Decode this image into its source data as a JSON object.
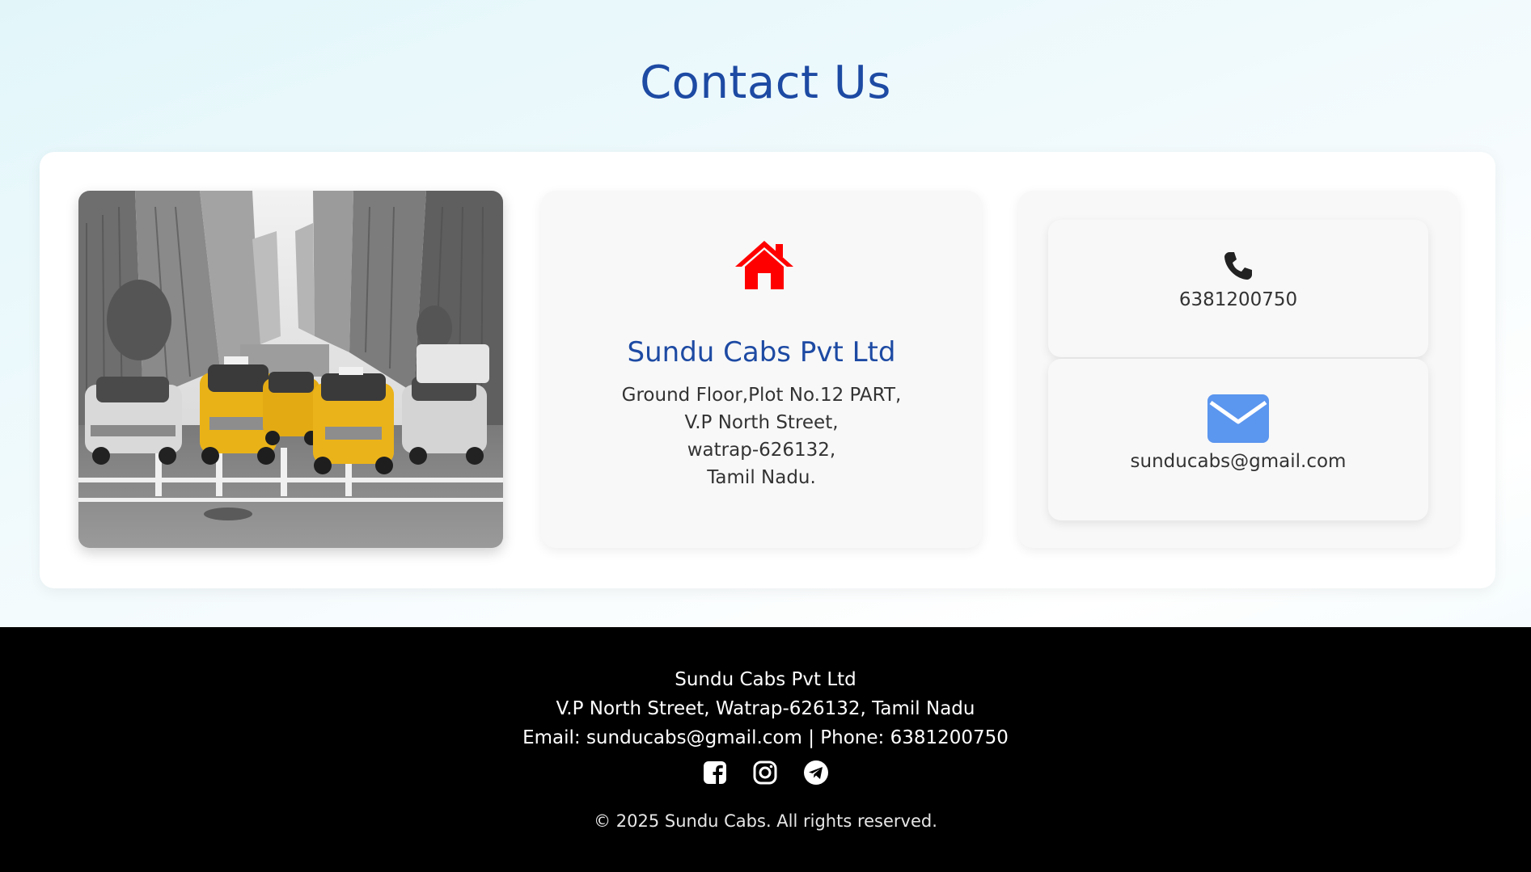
{
  "page": {
    "title": "Contact Us"
  },
  "address_card": {
    "icon": "home-icon",
    "company": "Sundu Cabs Pvt Ltd",
    "lines": [
      "Ground Floor,Plot No.12 PART,",
      "V.P North Street,",
      "watrap-626132,",
      "Tamil Nadu."
    ]
  },
  "contact_cards": {
    "phone": {
      "icon": "phone-icon",
      "value": "6381200750"
    },
    "email": {
      "icon": "envelope-icon",
      "value": "sunducabs@gmail.com"
    }
  },
  "footer": {
    "company": "Sundu Cabs Pvt Ltd",
    "address": "V.P North Street, Watrap-626132, Tamil Nadu",
    "contact": "Email: sunducabs@gmail.com | Phone: 6381200750",
    "social": [
      "facebook-icon",
      "instagram-icon",
      "telegram-icon"
    ],
    "copyright": "© 2025 Sundu Cabs. All rights reserved."
  },
  "colors": {
    "heading_blue": "#1d4aa3",
    "home_icon_red": "#ff0000",
    "envelope_blue": "#5b96ef",
    "footer_bg": "#000000"
  }
}
